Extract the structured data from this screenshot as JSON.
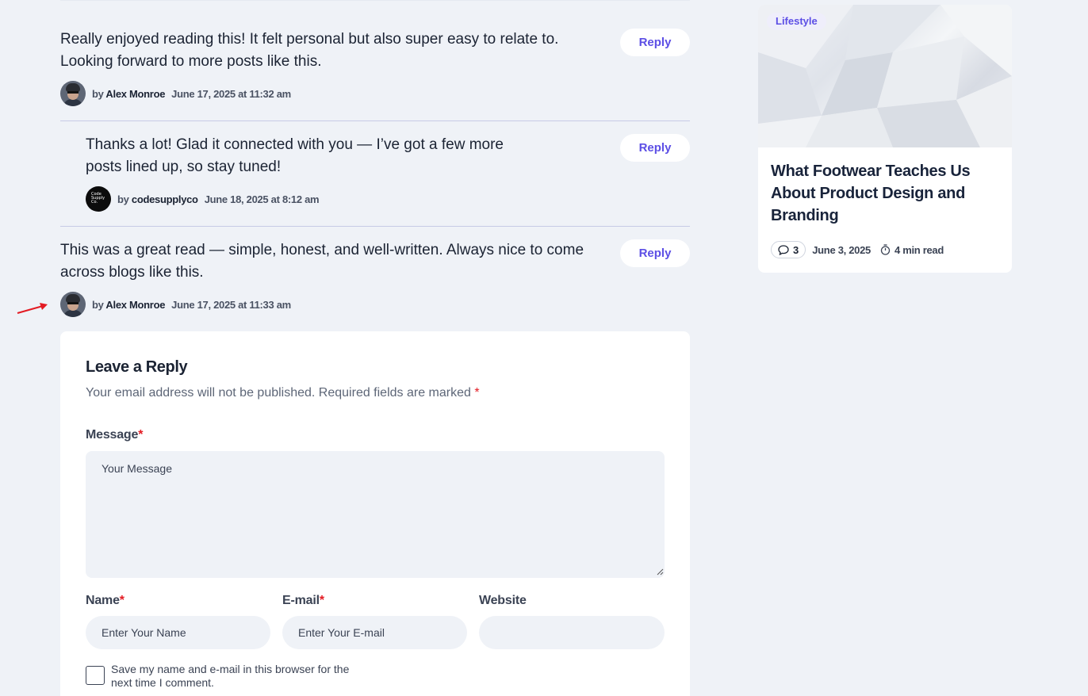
{
  "comments": [
    {
      "text": "Really enjoyed reading this! It felt personal but also super easy to relate to. Looking forward to more posts like this.",
      "by_prefix": "by",
      "author": "Alex Monroe",
      "date": "June 17, 2025 at 11:32 am",
      "reply_label": "Reply"
    },
    {
      "text": "Thanks a lot! Glad it connected with you — I’ve got a few more posts lined up, so stay tuned!",
      "by_prefix": "by",
      "author": "codesupplyco",
      "date": "June 18, 2025 at 8:12 am",
      "reply_label": "Reply",
      "avatar_text": "Code Supply Co."
    },
    {
      "text": "This was a great read — simple, honest, and well-written. Always nice to come across blogs like this.",
      "by_prefix": "by",
      "author": "Alex Monroe",
      "date": "June 17, 2025 at 11:33 am",
      "reply_label": "Reply"
    }
  ],
  "form": {
    "title": "Leave a Reply",
    "note": "Your email address will not be published. Required fields are marked",
    "required_mark": "*",
    "message_label": "Message",
    "message_placeholder": "Your Message",
    "name_label": "Name",
    "name_placeholder": "Enter Your Name",
    "email_label": "E-mail",
    "email_placeholder": "Enter Your E-mail",
    "website_label": "Website",
    "website_placeholder": "",
    "save_label": "Save my name and e-mail in this browser for the next time I comment."
  },
  "sidebar_post": {
    "category": "Lifestyle",
    "title": "What Footwear Teaches Us About Product Design and Branding",
    "comment_count": "3",
    "date": "June 3, 2025",
    "read_time": "4 min read"
  },
  "colors": {
    "accent": "#5c4ee5",
    "background": "#eff2f7",
    "required": "#e31b23",
    "annotation_arrow": "#e31b23"
  }
}
